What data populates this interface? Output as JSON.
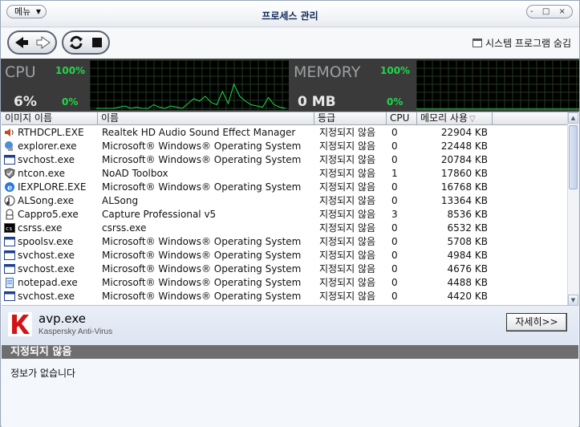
{
  "window": {
    "title": "프로세스 관리",
    "menu_label": "메뉴",
    "controls": "- □ ×"
  },
  "toolbar": {
    "hide_system_label": "시스템 프로그램 숨김"
  },
  "monitor": {
    "cpu": {
      "label": "CPU",
      "max": "100%",
      "min": "0%",
      "value": "6%",
      "graph": [
        0,
        0,
        0,
        0,
        1,
        2,
        0,
        1,
        0,
        0,
        3,
        1,
        0,
        2,
        1,
        0,
        4,
        8,
        6,
        10,
        5,
        3,
        14,
        4,
        20,
        10,
        6,
        3,
        2,
        1,
        9,
        3,
        1,
        0
      ]
    },
    "memory": {
      "label": "MEMORY",
      "max": "100%",
      "min": "0%",
      "value": "0 MB"
    },
    "accent_green": "#22d64a"
  },
  "table": {
    "columns": [
      "이미지 이름",
      "이름",
      "등급",
      "CPU",
      "메모리 사용"
    ],
    "rows": [
      {
        "image": "RTHDCPL.EXE",
        "name": "Realtek HD Audio Sound Effect Manager",
        "priority": "지정되지 않음",
        "cpu": "0",
        "memory": "22904 KB",
        "icon": "speaker-icon"
      },
      {
        "image": "explorer.exe",
        "name": "Microsoft® Windows® Operating System",
        "priority": "지정되지 않음",
        "cpu": "0",
        "memory": "22448 KB",
        "icon": "explorer-icon"
      },
      {
        "image": "svchost.exe",
        "name": "Microsoft® Windows® Operating System",
        "priority": "지정되지 않음",
        "cpu": "0",
        "memory": "20784 KB",
        "icon": "window-icon"
      },
      {
        "image": "ntcon.exe",
        "name": "NoAD Toolbox",
        "priority": "지정되지 않음",
        "cpu": "1",
        "memory": "17860 KB",
        "icon": "shield-icon"
      },
      {
        "image": "IEXPLORE.EXE",
        "name": "Microsoft® Windows® Operating System",
        "priority": "지정되지 않음",
        "cpu": "0",
        "memory": "16768 KB",
        "icon": "ie-icon"
      },
      {
        "image": "ALSong.exe",
        "name": "ALSong",
        "priority": "지정되지 않음",
        "cpu": "0",
        "memory": "13364 KB",
        "icon": "music-icon"
      },
      {
        "image": "Cappro5.exe",
        "name": "Capture Professional v5",
        "priority": "지정되지 않음",
        "cpu": "3",
        "memory": "8536 KB",
        "icon": "camera-icon"
      },
      {
        "image": "csrss.exe",
        "name": "csrss.exe",
        "priority": "지정되지 않음",
        "cpu": "0",
        "memory": "6532 KB",
        "icon": "console-icon"
      },
      {
        "image": "spoolsv.exe",
        "name": "Microsoft® Windows® Operating System",
        "priority": "지정되지 않음",
        "cpu": "0",
        "memory": "5708 KB",
        "icon": "window-icon"
      },
      {
        "image": "svchost.exe",
        "name": "Microsoft® Windows® Operating System",
        "priority": "지정되지 않음",
        "cpu": "0",
        "memory": "4984 KB",
        "icon": "window-icon"
      },
      {
        "image": "svchost.exe",
        "name": "Microsoft® Windows® Operating System",
        "priority": "지정되지 않음",
        "cpu": "0",
        "memory": "4676 KB",
        "icon": "window-icon"
      },
      {
        "image": "notepad.exe",
        "name": "Microsoft® Windows® Operating System",
        "priority": "지정되지 않음",
        "cpu": "0",
        "memory": "4488 KB",
        "icon": "notepad-icon"
      },
      {
        "image": "svchost.exe",
        "name": "Microsoft® Windows® Operating System",
        "priority": "지정되지 않음",
        "cpu": "0",
        "memory": "4420 KB",
        "icon": "window-icon"
      }
    ]
  },
  "details": {
    "process": "avp.exe",
    "description": "Kaspersky Anti-Virus",
    "button_label": "자세히>>",
    "priority": "지정되지 않음",
    "info": "정보가 없습니다"
  }
}
